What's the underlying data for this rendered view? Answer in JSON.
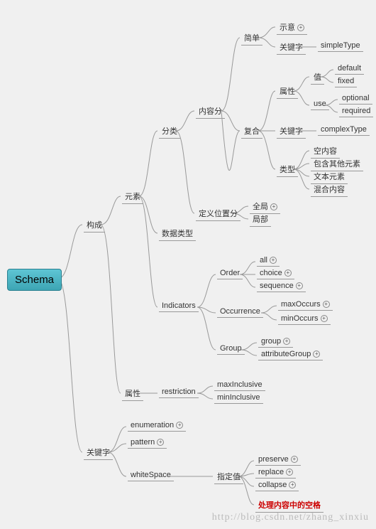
{
  "root": "Schema",
  "n": {
    "gc": "构成",
    "ys": "元素",
    "fl": "分类",
    "nrf": "内容分",
    "jd": "简单",
    "sy": "示意",
    "gjz1": "关键字",
    "st": "simpleType",
    "fh": "复合",
    "sx1": "属性",
    "zhi": "值",
    "def": "default",
    "fix": "fixed",
    "use": "use",
    "opt": "optional",
    "req": "required",
    "gjz2": "关键字",
    "ct": "complexType",
    "lx": "类型",
    "knr": "空内容",
    "bhqt": "包含其他元素",
    "wbys": "文本元素",
    "hhnr": "混合内容",
    "dywzf": "定义位置分",
    "qj": "全局",
    "jb": "局部",
    "sjlx": "数据类型",
    "ind": "Indicators",
    "ord": "Order",
    "all": "all",
    "cho": "choice",
    "seq": "sequence",
    "occ": "Occurrence",
    "maxo": "maxOccurs",
    "mino": "minOccurs",
    "grp": "Group",
    "grp1": "group",
    "attrg": "attributeGroup",
    "sx2": "属性",
    "rest": "restriction",
    "maxi": "maxInclusive",
    "mini": "minInclusive",
    "gjz3": "关键字",
    "enum": "enumeration",
    "pat": "pattern",
    "ws": "whiteSpace",
    "zdz": "指定值",
    "pres": "preserve",
    "repl": "replace",
    "coll": "collapse",
    "hl": "处理内容中的空格"
  },
  "watermark": "http://blog.csdn.net/zhang_xinxiu"
}
